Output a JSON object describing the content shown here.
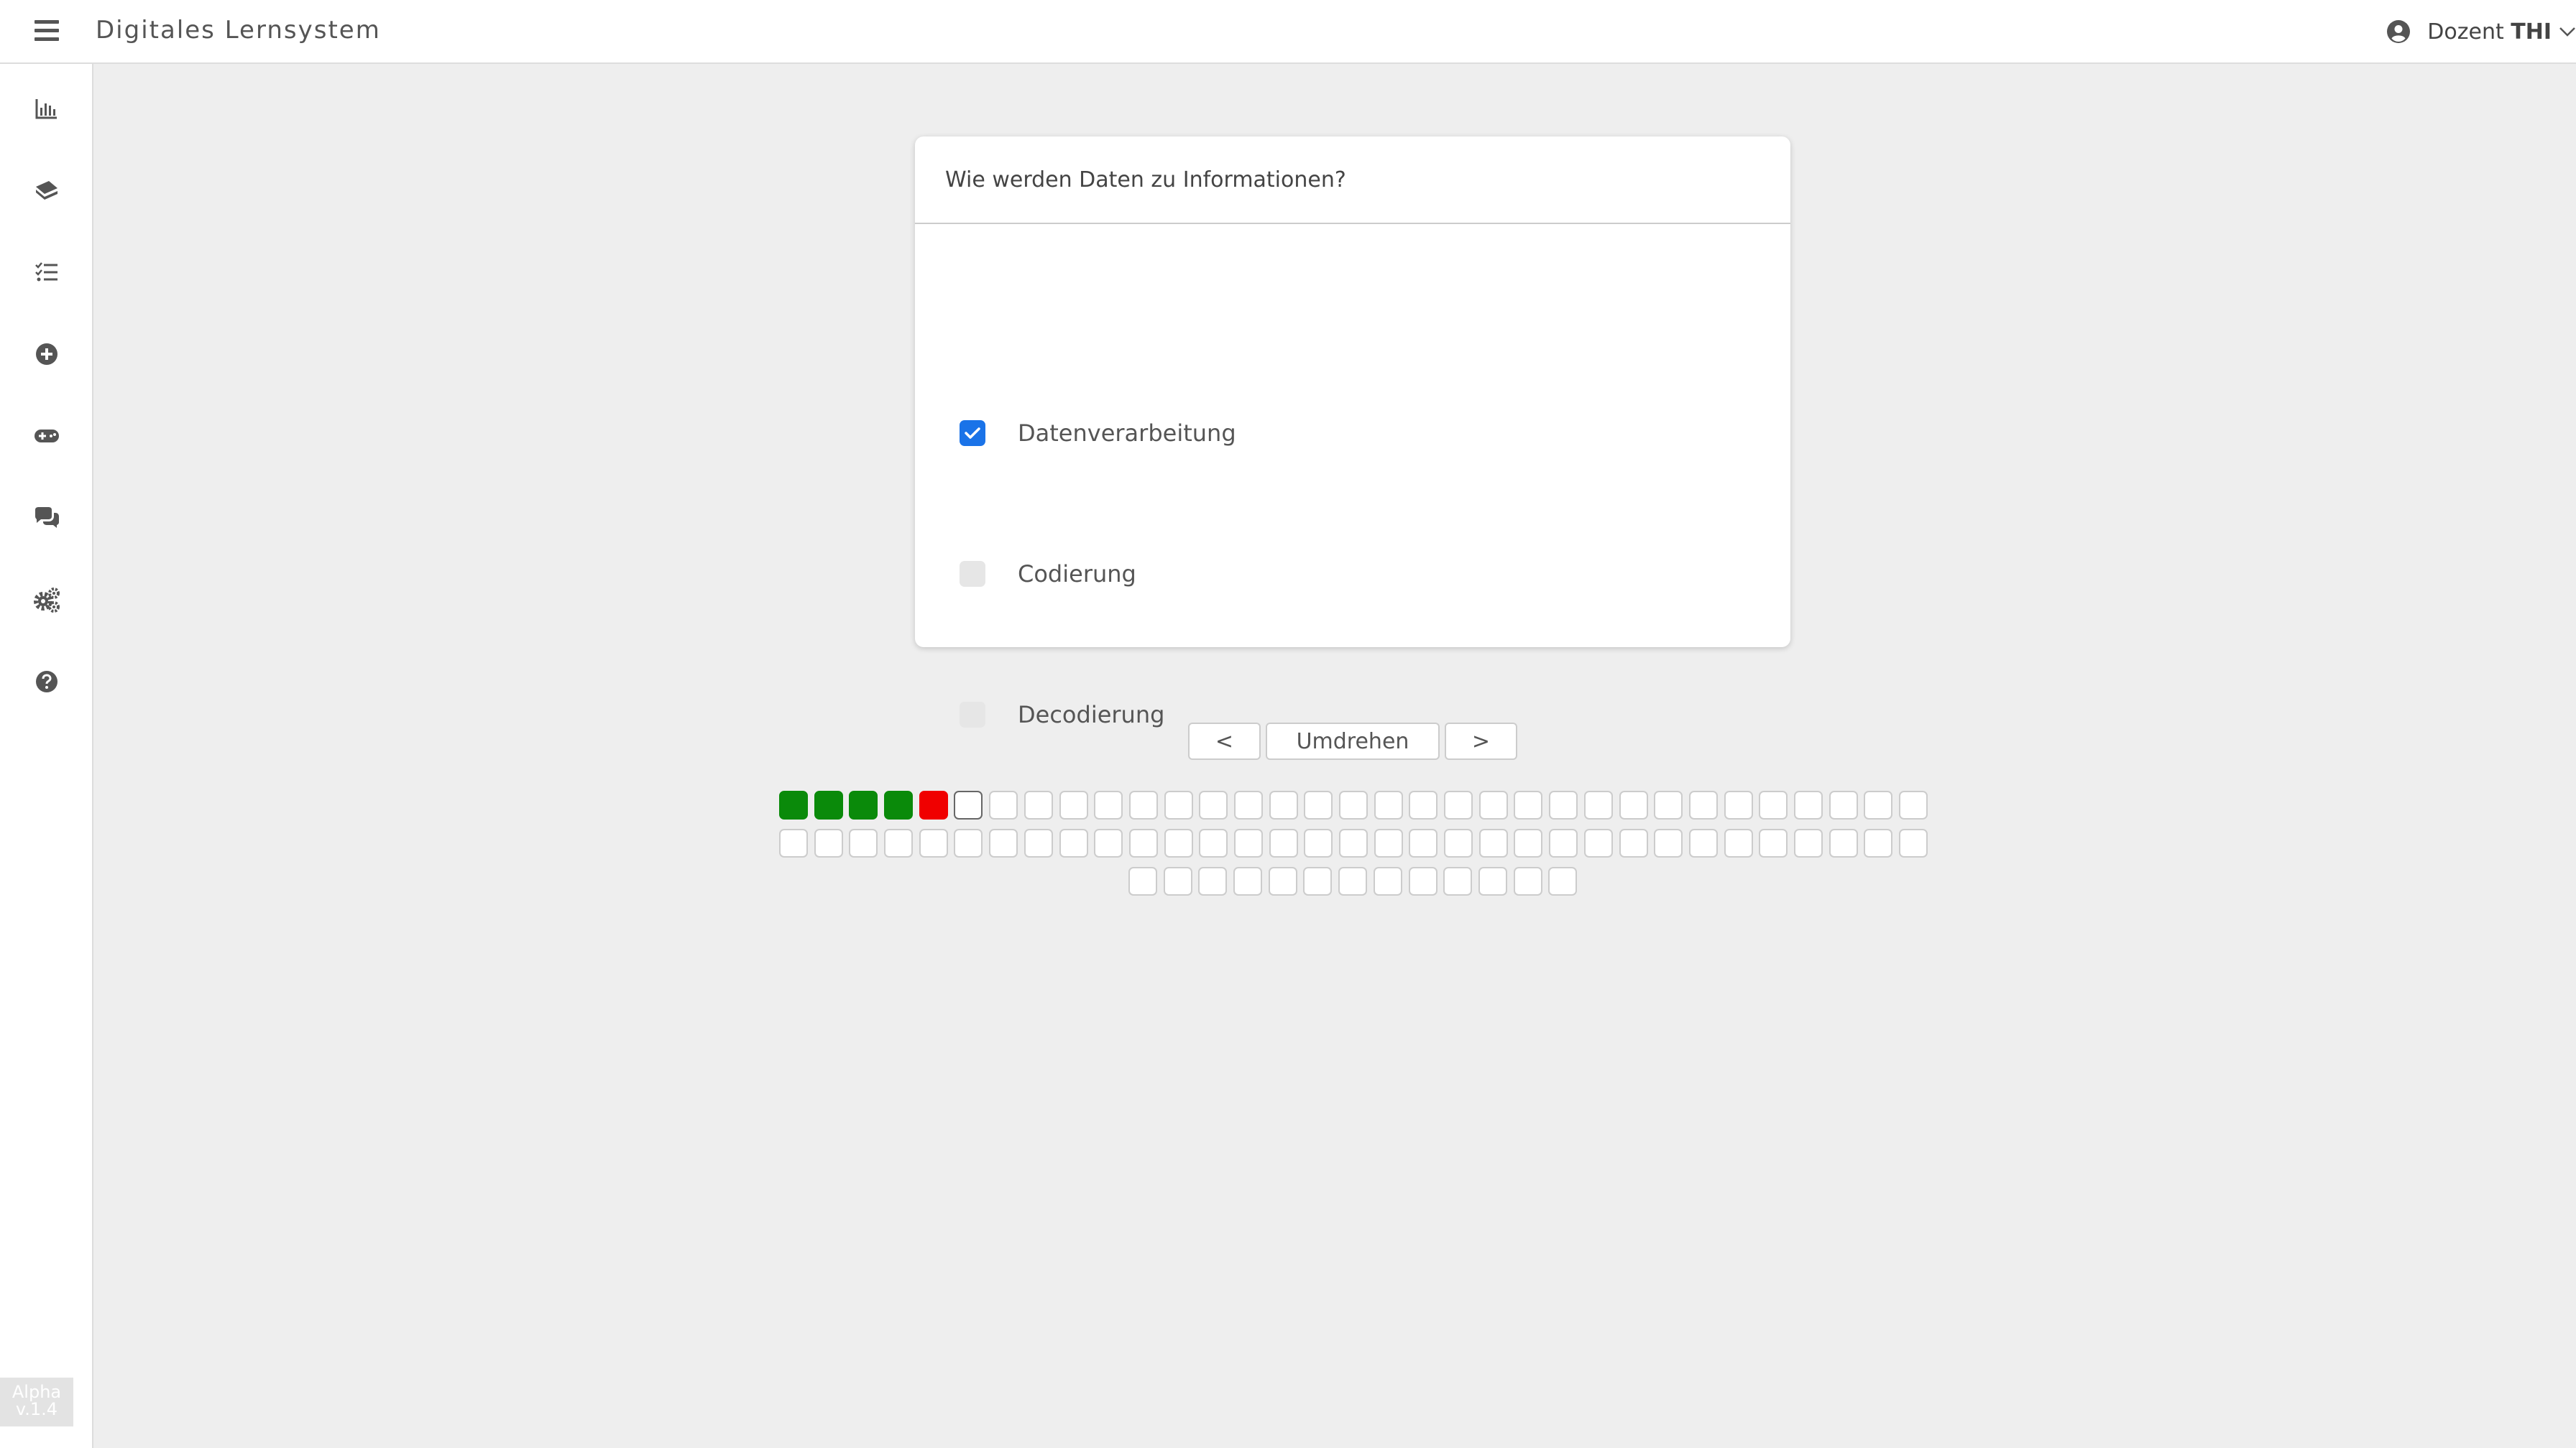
{
  "app": {
    "title": "Digitales Lernsystem"
  },
  "user": {
    "role": "Dozent",
    "org": "THI"
  },
  "sidebar": {
    "items": [
      {
        "icon": "bar-chart-icon"
      },
      {
        "icon": "cards-icon"
      },
      {
        "icon": "task-list-icon"
      },
      {
        "icon": "add-circle-icon"
      },
      {
        "icon": "gamepad-icon"
      },
      {
        "icon": "chat-icon"
      },
      {
        "icon": "settings-gears-icon"
      },
      {
        "icon": "help-icon"
      }
    ],
    "version": {
      "stage": "Alpha",
      "number": "v.1.4"
    }
  },
  "card": {
    "question": "Wie werden Daten zu Informationen?",
    "options": [
      {
        "label": "Datenverarbeitung",
        "checked": true
      },
      {
        "label": "Codierung",
        "checked": false
      },
      {
        "label": "Decodierung",
        "checked": false
      }
    ]
  },
  "controls": {
    "prev_label": "<",
    "flip_label": "Umdrehen",
    "next_label": ">"
  },
  "progress": {
    "statuses": [
      "correct",
      "correct",
      "correct",
      "correct",
      "wrong",
      "current",
      "open",
      "open",
      "open",
      "open",
      "open",
      "open",
      "open",
      "open",
      "open",
      "open",
      "open",
      "open",
      "open",
      "open",
      "open",
      "open",
      "open",
      "open",
      "open",
      "open",
      "open",
      "open",
      "open",
      "open",
      "open",
      "open",
      "open",
      "open",
      "open",
      "open",
      "open",
      "open",
      "open",
      "open",
      "open",
      "open",
      "open",
      "open",
      "open",
      "open",
      "open",
      "open",
      "open",
      "open",
      "open",
      "open",
      "open",
      "open",
      "open",
      "open",
      "open",
      "open",
      "open",
      "open",
      "open",
      "open",
      "open",
      "open",
      "open",
      "open",
      "open",
      "open",
      "open",
      "open",
      "open",
      "open",
      "open",
      "open",
      "open",
      "open",
      "open",
      "open",
      "open"
    ]
  },
  "colors": {
    "accent": "#1a73e8",
    "correct": "#0a8a0a",
    "wrong": "#f00000"
  }
}
